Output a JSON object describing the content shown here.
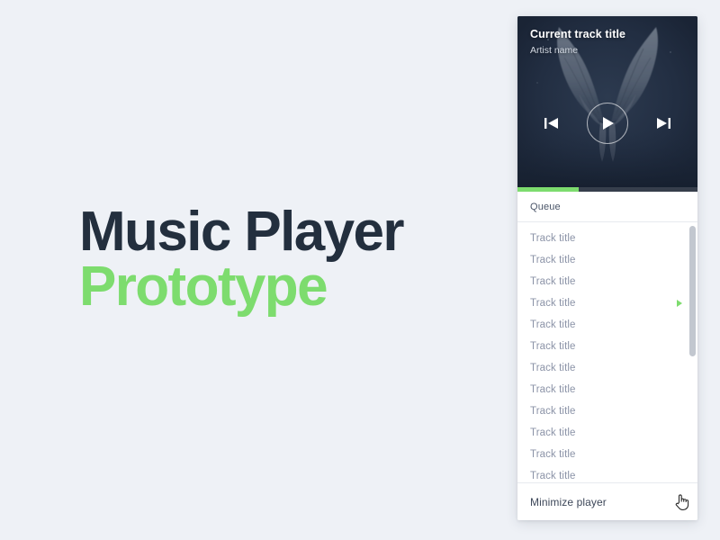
{
  "page": {
    "background_color": "#eef1f6",
    "headline": {
      "line1": "Music Player",
      "line2": "Prototype",
      "line1_color": "#232f3e",
      "line2_color": "#7ddc6e"
    }
  },
  "player": {
    "now_playing": {
      "track_title": "Current track title",
      "artist_name": "Artist name",
      "artwork_background": "#1e2a3d",
      "artwork_description": "angel-wings-album-art"
    },
    "controls": {
      "previous_label": "Previous track",
      "play_label": "Play",
      "next_label": "Next track"
    },
    "progress": {
      "percent": 34,
      "fill_color": "#7ddc6e"
    },
    "queue": {
      "header_label": "Queue",
      "now_playing_index": 3,
      "tracks": [
        {
          "title": "Track title",
          "playing": false
        },
        {
          "title": "Track title",
          "playing": false
        },
        {
          "title": "Track title",
          "playing": false
        },
        {
          "title": "Track title",
          "playing": true
        },
        {
          "title": "Track title",
          "playing": false
        },
        {
          "title": "Track title",
          "playing": false
        },
        {
          "title": "Track title",
          "playing": false
        },
        {
          "title": "Track title",
          "playing": false
        },
        {
          "title": "Track title",
          "playing": false
        },
        {
          "title": "Track title",
          "playing": false
        },
        {
          "title": "Track title",
          "playing": false
        },
        {
          "title": "Track title",
          "playing": false
        }
      ]
    },
    "footer": {
      "minimize_label": "Minimize player",
      "chevron_glyph": "›"
    }
  }
}
